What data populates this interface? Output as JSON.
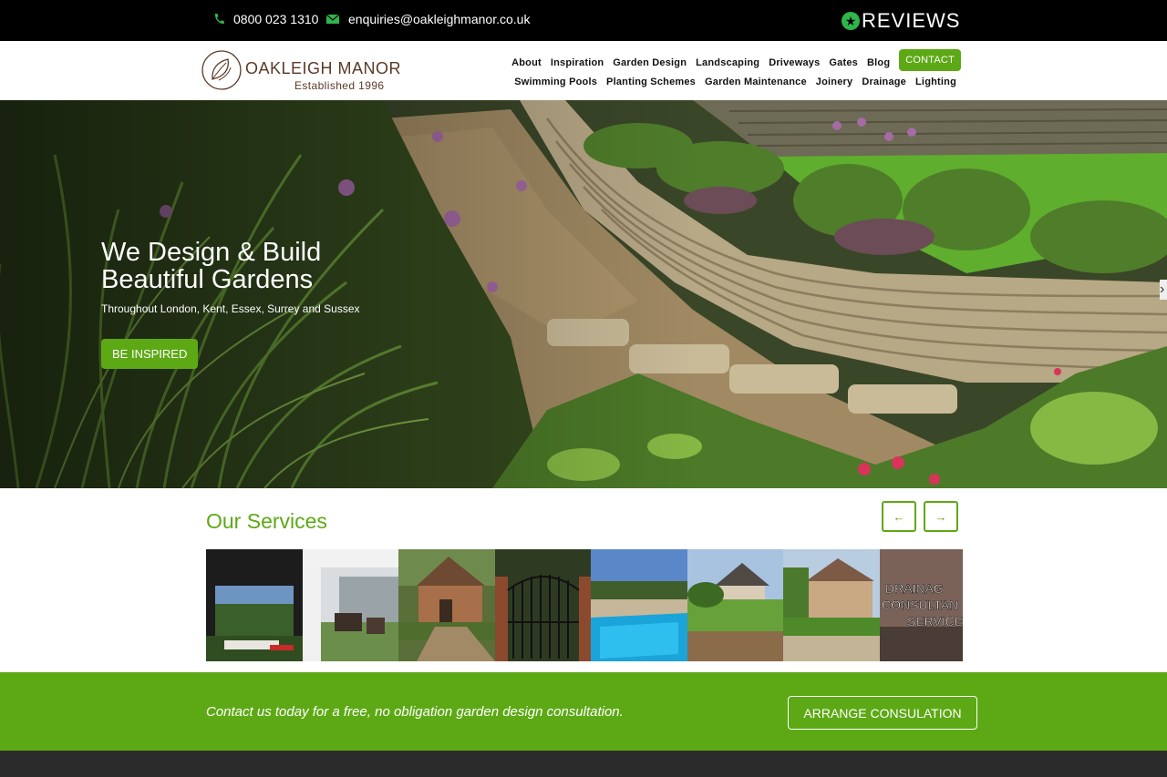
{
  "topbar": {
    "phone": "0800 023 1310",
    "email": "enquiries@oakleighmanor.co.uk",
    "reviews_label": "REVIEWS"
  },
  "logo": {
    "name": "OAKLEIGH MANOR",
    "tagline": "Established 1996"
  },
  "nav": {
    "row1": [
      "About",
      "Inspiration",
      "Garden Design",
      "Landscaping",
      "Driveways",
      "Gates",
      "Blog"
    ],
    "contact": "CONTACT",
    "row2": [
      "Swimming Pools",
      "Planting Schemes",
      "Garden Maintenance",
      "Joinery",
      "Drainage",
      "Lighting"
    ]
  },
  "hero": {
    "title": "We Design & Build Beautiful Gardens",
    "subtitle": "Throughout London, Kent, Essex, Surrey and Sussex",
    "button": "BE INSPIRED"
  },
  "services": {
    "heading": "Our Services",
    "prev_icon": "arrow-left-icon",
    "next_icon": "arrow-right-icon",
    "drainage_text": "DRAINAGE CONSULTANCY SERVICES"
  },
  "band": {
    "message": "Contact us today for a free, no obligation garden design consultation.",
    "button": "ARRANGE CONSULATION"
  },
  "colors": {
    "brand_green": "#5da915",
    "logo_brown": "#5a3a26",
    "topbar_bg": "#000000",
    "footer_bg": "#2b2b2b"
  }
}
